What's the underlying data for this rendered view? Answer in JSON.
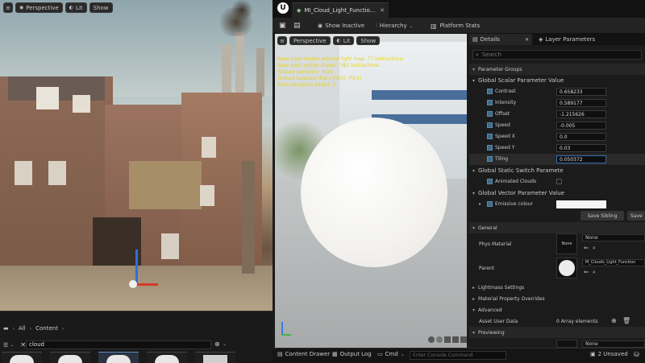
{
  "left_viewport": {
    "toolbar": [
      "Perspective",
      "Lit",
      "Show"
    ]
  },
  "content_browser": {
    "breadcrumb": [
      "All",
      "Content"
    ],
    "search_value": "cloud"
  },
  "editor": {
    "tab_title": "MI_Cloud_Light_Functio...",
    "toolbar": {
      "show_inactive": "Show Inactive",
      "hierarchy": "Hierarchy",
      "platform_stats": "Platform Stats"
    },
    "viewport_toolbar": [
      "Perspective",
      "Lit",
      "Show"
    ],
    "stats_lines": [
      "Base pass shader without light map: 77 instructions",
      "Base pass vertex shader: 382 instructions",
      "Texture samplers: 4/16",
      "Texture Lookups (Est.) VS(0), PS(4)",
      "Num Samplers added: 1"
    ]
  },
  "details": {
    "tabs": [
      "Details",
      "Layer Parameters"
    ],
    "search_placeholder": "Search",
    "parameter_groups": "Parameter Groups",
    "scalar_group": "Global Scalar Parameter Value",
    "scalars": [
      {
        "name": "Contrast",
        "value": "0.658233"
      },
      {
        "name": "Intensity",
        "value": "0.589177"
      },
      {
        "name": "Offset",
        "value": "-1.215626"
      },
      {
        "name": "Speed",
        "value": "-0.005"
      },
      {
        "name": "Speed X",
        "value": "0.0"
      },
      {
        "name": "Speed Y",
        "value": "0.03"
      },
      {
        "name": "Tiling",
        "value": "0.050372"
      }
    ],
    "static_switch_group": "Global Static Switch Paramete",
    "static_switch": {
      "name": "Animated Clouds"
    },
    "vector_group": "Global Vector Parameter Value",
    "vector": {
      "name": "Emissive colour"
    },
    "save_sibling": "Save Sibling",
    "save_child": "Save",
    "general": "General",
    "phys_material_label": "Phys Material",
    "phys_material_thumb": "None",
    "phys_material_value": "None",
    "parent_label": "Parent",
    "parent_value": "M_Clouds_Light_Function",
    "lightmass": "Lightmass Settings",
    "material_property_overrides": "Material Property Overrides",
    "advanced": "Advanced",
    "asset_user_data_label": "Asset User Data",
    "asset_user_data_value": "0 Array elements",
    "previewing": "Previewing",
    "previewing_value": "None"
  },
  "statusbar": {
    "content_drawer": "Content Drawer",
    "output_log": "Output Log",
    "cmd": "Cmd",
    "console_placeholder": "Enter Console Command",
    "unsaved": "2 Unsaved"
  },
  "colors": {
    "accent": "#3d6a8a",
    "selected_field": "#2d6fb0"
  }
}
